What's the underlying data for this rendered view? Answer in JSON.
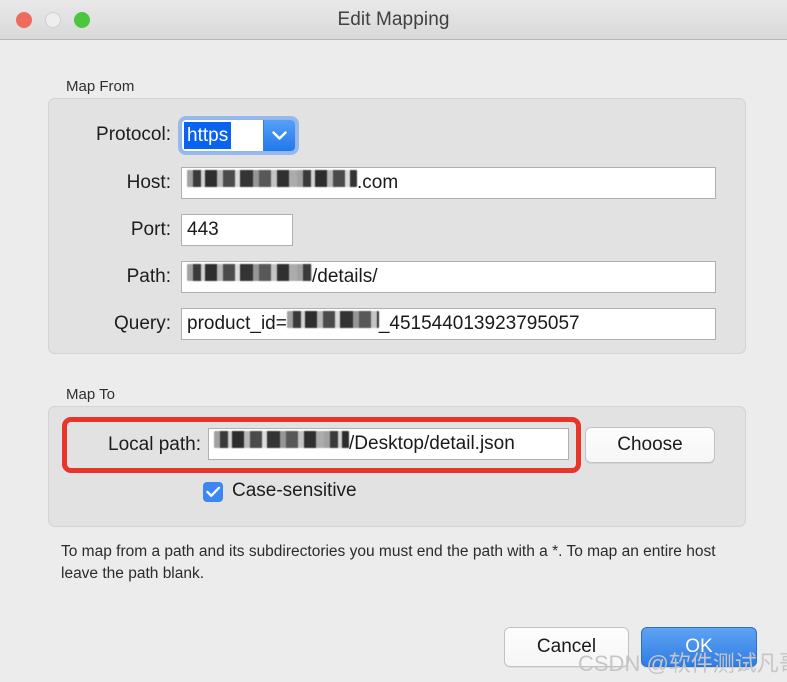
{
  "window": {
    "title": "Edit Mapping",
    "traffic_lights": {
      "close": "close-button",
      "minimize": "minimize-button",
      "zoom": "zoom-button"
    },
    "colors": {
      "close": "#ee6a5f",
      "minimize": "#eeeeee",
      "zoom": "#4cc540",
      "accent_blue": "#2f7de4",
      "selection_blue": "#0a62f0",
      "annotation_red": "#e8352b",
      "window_bg": "#ececec",
      "groupbox_bg": "#e2e2e2"
    }
  },
  "map_from": {
    "group_label": "Map From",
    "protocol": {
      "label": "Protocol:",
      "value": "https",
      "selected": true,
      "dropdown_icon": "chevron-down-icon"
    },
    "host": {
      "label": "Host:",
      "value_redacted_prefix": "",
      "value_suffix": ".com",
      "redacted": true
    },
    "port": {
      "label": "Port:",
      "value": "443"
    },
    "path": {
      "label": "Path:",
      "value_suffix": "/details/",
      "redacted": true
    },
    "query": {
      "label": "Query:",
      "value_prefix": "product_id=",
      "value_suffix": "_451544013923795057",
      "redacted": true
    }
  },
  "map_to": {
    "group_label": "Map To",
    "local_path": {
      "label": "Local path:",
      "value_suffix": "/Desktop/detail.json",
      "redacted": true
    },
    "choose_button": "Choose",
    "case_sensitive": {
      "label": "Case-sensitive",
      "checked": true,
      "check_icon": "checkmark-icon"
    }
  },
  "help_text": "To map from a path and its subdirectories you must end the path with a *. To map an entire host leave the path blank.",
  "footer": {
    "cancel_label": "Cancel",
    "ok_label": "OK"
  },
  "watermark": "CSDN @软件测试凡哥"
}
